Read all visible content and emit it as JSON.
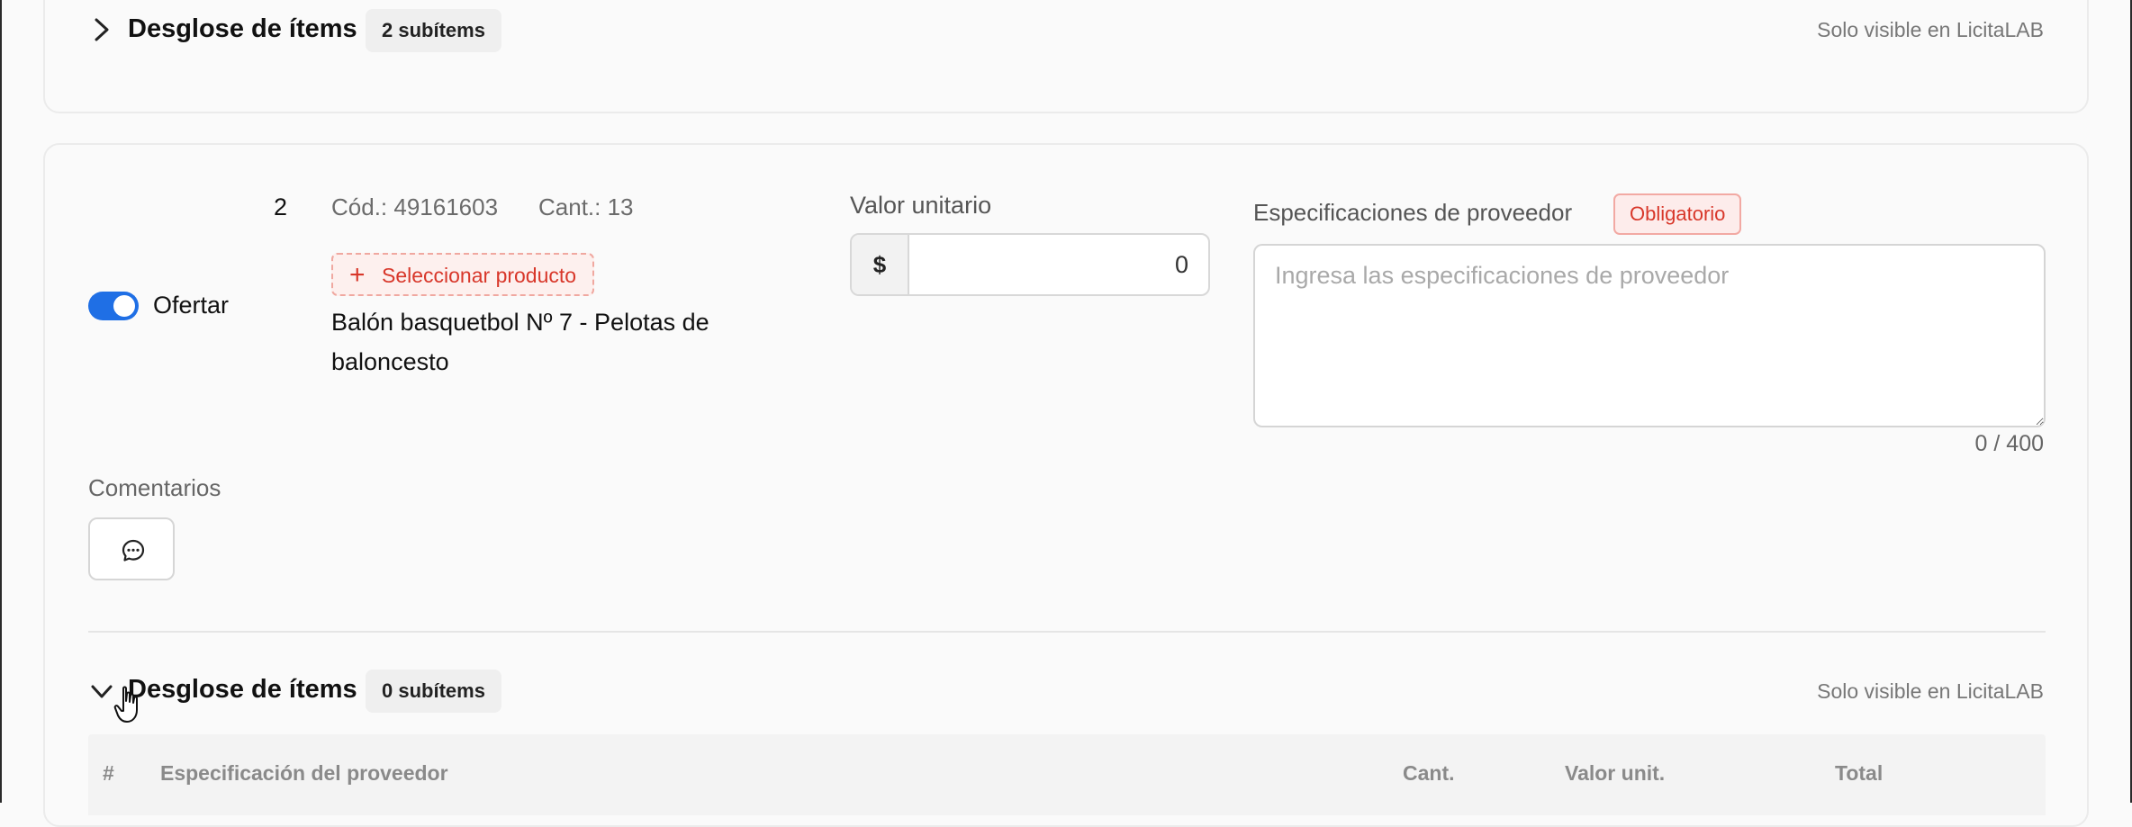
{
  "top_section": {
    "breakdown_title": "Desglose de ítems",
    "subitems_badge": "2 subítems",
    "visibility_note": "Solo visible en LicitaLAB"
  },
  "item": {
    "number": "2",
    "code": "Cód.: 49161603",
    "quantity": "Cant.: 13",
    "offer_label": "Ofertar",
    "offer_enabled": true,
    "select_product_label": "Seleccionar producto",
    "product_name_line1": "Balón basquetbol Nº 7 - Pelotas de",
    "product_name_line2": "baloncesto",
    "unit_value_label": "Valor unitario",
    "currency_symbol": "$",
    "unit_value": "0",
    "specs_label": "Especificaciones de proveedor",
    "required_badge": "Obligatorio",
    "specs_placeholder": "Ingresa las especificaciones de proveedor",
    "char_counter": "0 / 400",
    "comments_label": "Comentarios"
  },
  "bottom_section": {
    "breakdown_title": "Desglose de ítems",
    "subitems_badge": "0 subítems",
    "visibility_note": "Solo visible en LicitaLAB"
  },
  "subitems_table": {
    "columns": [
      "#",
      "Especificación del proveedor",
      "Cant.",
      "Valor unit.",
      "Total"
    ]
  },
  "colors": {
    "toggle_on": "#1f6fe5",
    "danger": "#d8372a",
    "muted_text": "#6b6b6b"
  }
}
